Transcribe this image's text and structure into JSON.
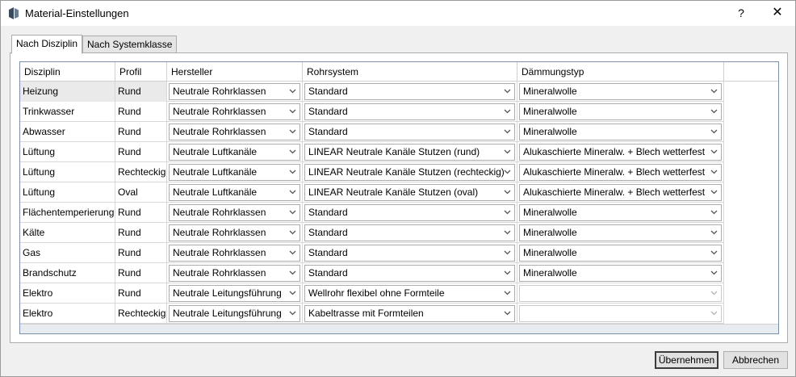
{
  "window": {
    "title": "Material-Einstellungen",
    "help_label": "?",
    "close_label": "✕"
  },
  "tabs": [
    {
      "label": "Nach Disziplin",
      "active": true
    },
    {
      "label": "Nach Systemklasse",
      "active": false
    }
  ],
  "grid": {
    "columns": [
      "Disziplin",
      "Profil",
      "Hersteller",
      "Rohrsystem",
      "Dämmungstyp"
    ],
    "rows": [
      {
        "disziplin": "Heizung",
        "profil": "Rund",
        "hersteller": "Neutrale Rohrklassen",
        "rohrsystem": "Standard",
        "daemmung": "Mineralwolle",
        "daemmung_enabled": true
      },
      {
        "disziplin": "Trinkwasser",
        "profil": "Rund",
        "hersteller": "Neutrale Rohrklassen",
        "rohrsystem": "Standard",
        "daemmung": "Mineralwolle",
        "daemmung_enabled": true
      },
      {
        "disziplin": "Abwasser",
        "profil": "Rund",
        "hersteller": "Neutrale Rohrklassen",
        "rohrsystem": "Standard",
        "daemmung": "Mineralwolle",
        "daemmung_enabled": true
      },
      {
        "disziplin": "Lüftung",
        "profil": "Rund",
        "hersteller": "Neutrale Luftkanäle",
        "rohrsystem": "LINEAR Neutrale Kanäle Stutzen (rund)",
        "daemmung": "Alukaschierte Mineralw. + Blech wetterfest",
        "daemmung_enabled": true
      },
      {
        "disziplin": "Lüftung",
        "profil": "Rechteckig",
        "hersteller": "Neutrale Luftkanäle",
        "rohrsystem": "LINEAR Neutrale Kanäle Stutzen (rechteckig)",
        "daemmung": "Alukaschierte Mineralw. + Blech wetterfest",
        "daemmung_enabled": true
      },
      {
        "disziplin": "Lüftung",
        "profil": "Oval",
        "hersteller": "Neutrale Luftkanäle",
        "rohrsystem": "LINEAR Neutrale Kanäle Stutzen (oval)",
        "daemmung": "Alukaschierte Mineralw. + Blech wetterfest",
        "daemmung_enabled": true
      },
      {
        "disziplin": "Flächentemperierung",
        "profil": "Rund",
        "hersteller": "Neutrale Rohrklassen",
        "rohrsystem": "Standard",
        "daemmung": "Mineralwolle",
        "daemmung_enabled": true
      },
      {
        "disziplin": "Kälte",
        "profil": "Rund",
        "hersteller": "Neutrale Rohrklassen",
        "rohrsystem": "Standard",
        "daemmung": "Mineralwolle",
        "daemmung_enabled": true
      },
      {
        "disziplin": "Gas",
        "profil": "Rund",
        "hersteller": "Neutrale Rohrklassen",
        "rohrsystem": "Standard",
        "daemmung": "Mineralwolle",
        "daemmung_enabled": true
      },
      {
        "disziplin": "Brandschutz",
        "profil": "Rund",
        "hersteller": "Neutrale Rohrklassen",
        "rohrsystem": "Standard",
        "daemmung": "Mineralwolle",
        "daemmung_enabled": true
      },
      {
        "disziplin": "Elektro",
        "profil": "Rund",
        "hersteller": "Neutrale Leitungsführung",
        "rohrsystem": "Wellrohr flexibel ohne Formteile",
        "daemmung": "",
        "daemmung_enabled": false
      },
      {
        "disziplin": "Elektro",
        "profil": "Rechteckig",
        "hersteller": "Neutrale Leitungsführung",
        "rohrsystem": "Kabeltrasse mit Formteilen",
        "daemmung": "",
        "daemmung_enabled": false
      }
    ]
  },
  "buttons": {
    "apply": "Übernehmen",
    "cancel": "Abbrechen"
  },
  "colors": {
    "accent": "#3c3c3c",
    "grid_border": "#7a8fa8",
    "selected_row": "#eaeaea"
  },
  "icons": {
    "app": "app-logo-icon",
    "combo": "chevron-down-icon"
  }
}
